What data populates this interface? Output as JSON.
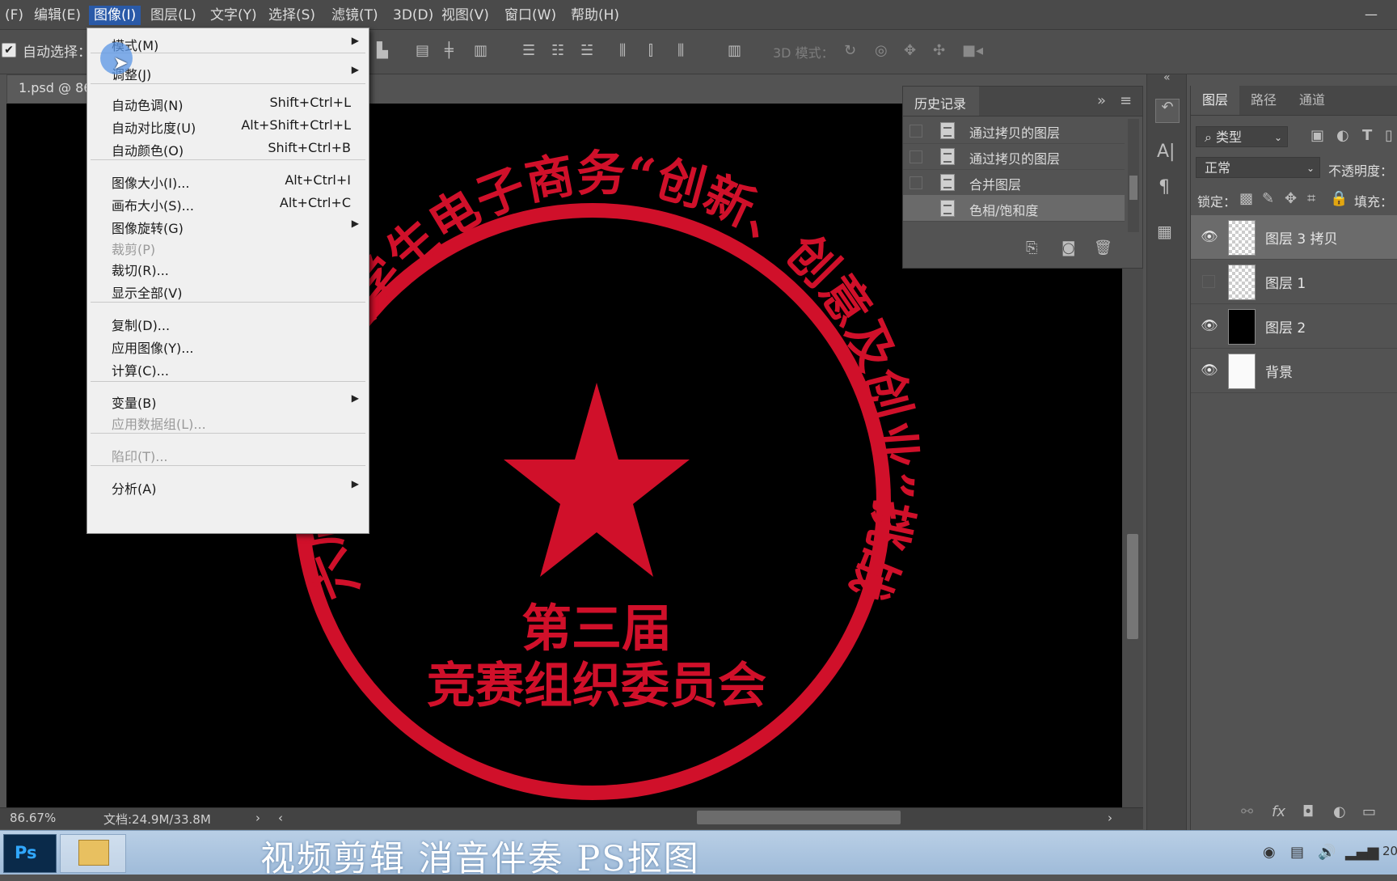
{
  "menubar": {
    "items": [
      "文件(F)",
      "编辑(E)",
      "图像(I)",
      "图层(L)",
      "文字(Y)",
      "选择(S)",
      "滤镜(T)",
      "3D(D)",
      "视图(V)",
      "窗口(W)",
      "帮助(H)"
    ],
    "visible_items": [
      "(F)",
      "编辑(E)",
      "图像(I)",
      "图层(L)",
      "文字(Y)",
      "选择(S)",
      "滤镜(T)",
      "3D(D)",
      "视图(V)",
      "窗口(W)",
      "帮助(H)"
    ],
    "active": "图像(I)"
  },
  "options_bar": {
    "auto_select_label": "自动选择：",
    "auto_select_checked": true,
    "mode_3d_label": "3D 模式："
  },
  "document": {
    "tab_title": "1.psd @ 86",
    "zoom": "86.67%",
    "doc_info": "文档:24.9M/33.8M"
  },
  "image_menu": {
    "items": [
      {
        "label": "模式(M)",
        "shortcut": "",
        "submenu": true,
        "disabled": false
      },
      {
        "label": "调整(J)",
        "shortcut": "",
        "submenu": true,
        "disabled": false
      },
      {
        "label": "自动色调(N)",
        "shortcut": "Shift+Ctrl+L",
        "submenu": false,
        "disabled": false
      },
      {
        "label": "自动对比度(U)",
        "shortcut": "Alt+Shift+Ctrl+L",
        "submenu": false,
        "disabled": false
      },
      {
        "label": "自动颜色(O)",
        "shortcut": "Shift+Ctrl+B",
        "submenu": false,
        "disabled": false
      },
      {
        "label": "图像大小(I)...",
        "shortcut": "Alt+Ctrl+I",
        "submenu": false,
        "disabled": false
      },
      {
        "label": "画布大小(S)...",
        "shortcut": "Alt+Ctrl+C",
        "submenu": false,
        "disabled": false
      },
      {
        "label": "图像旋转(G)",
        "shortcut": "",
        "submenu": true,
        "disabled": false
      },
      {
        "label": "裁剪(P)",
        "shortcut": "",
        "submenu": false,
        "disabled": true
      },
      {
        "label": "裁切(R)...",
        "shortcut": "",
        "submenu": false,
        "disabled": false
      },
      {
        "label": "显示全部(V)",
        "shortcut": "",
        "submenu": false,
        "disabled": false
      },
      {
        "label": "复制(D)...",
        "shortcut": "",
        "submenu": false,
        "disabled": false
      },
      {
        "label": "应用图像(Y)...",
        "shortcut": "",
        "submenu": false,
        "disabled": false
      },
      {
        "label": "计算(C)...",
        "shortcut": "",
        "submenu": false,
        "disabled": false
      },
      {
        "label": "变量(B)",
        "shortcut": "",
        "submenu": true,
        "disabled": false
      },
      {
        "label": "应用数据组(L)...",
        "shortcut": "",
        "submenu": false,
        "disabled": true
      },
      {
        "label": "陷印(T)...",
        "shortcut": "",
        "submenu": false,
        "disabled": true
      },
      {
        "label": "分析(A)",
        "shortcut": "",
        "submenu": true,
        "disabled": false
      }
    ]
  },
  "history_panel": {
    "title": "历史记录",
    "items": [
      "通过拷贝的图层",
      "通过拷贝的图层",
      "合并图层",
      "色相/饱和度"
    ],
    "selected_index": 3
  },
  "layers_panel": {
    "tabs": [
      "图层",
      "路径",
      "通道"
    ],
    "active_tab": "图层",
    "filter_label": "类型",
    "blend_mode": "正常",
    "opacity_label": "不透明度：",
    "lock_label": "锁定：",
    "fill_label": "填充：",
    "layers": [
      {
        "name": "图层 3 拷贝",
        "visible": true,
        "selected": true,
        "thumb": "checker"
      },
      {
        "name": "图层 1",
        "visible": false,
        "selected": false,
        "thumb": "checker"
      },
      {
        "name": "图层 2",
        "visible": true,
        "selected": false,
        "thumb": "black"
      },
      {
        "name": "背景",
        "visible": true,
        "selected": false,
        "thumb": "white"
      }
    ]
  },
  "seal": {
    "ring_text": "第六届浙江省大学生电子商务“创新、创意及创业”挑战赛",
    "center_line1": "第三届",
    "center_line2": "竞赛组织委员会",
    "color": "#d0102a"
  },
  "taskbar": {
    "ps_label": "Ps",
    "subtitle": "视频剪辑 消音伴奏 PS抠图",
    "clock_fragment": "20"
  },
  "colors": {
    "menu_active": "#2a5aa8",
    "seal_red": "#d0102a",
    "panel_bg": "#535353"
  }
}
